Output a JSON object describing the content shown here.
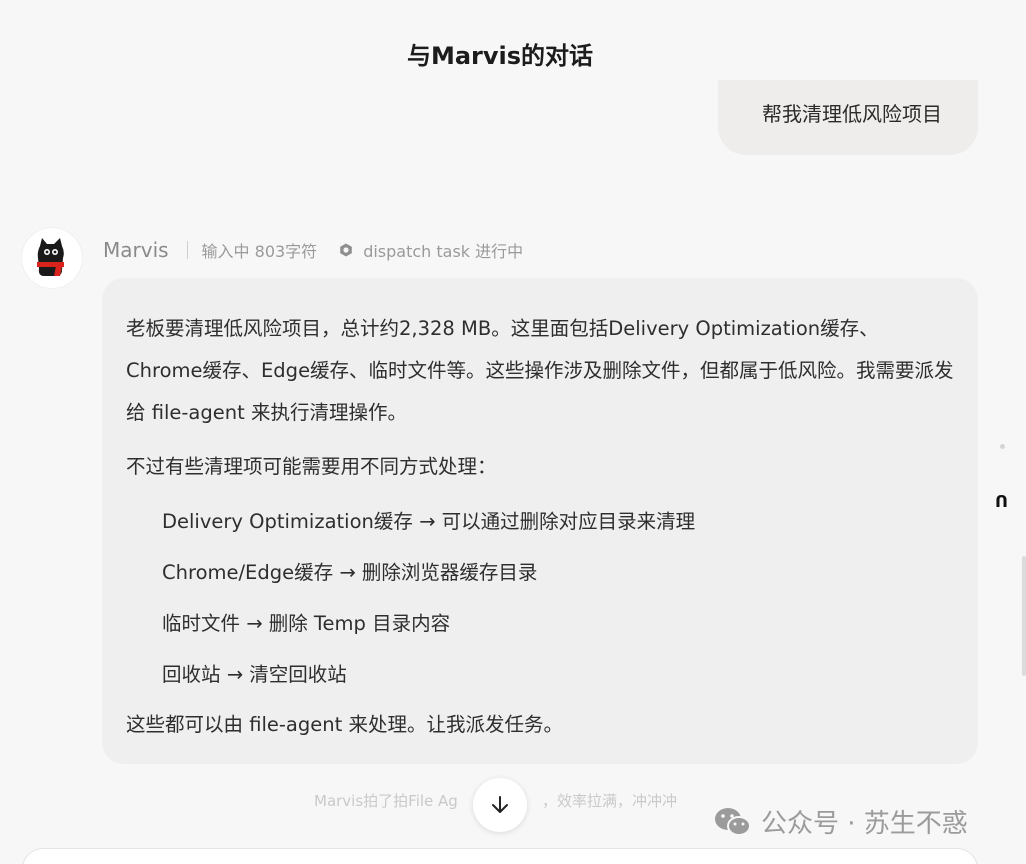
{
  "header": {
    "title": "与Marvis的对话"
  },
  "user_message": {
    "text": "帮我清理低风险项目"
  },
  "assistant": {
    "name": "Marvis",
    "typing_status": "输入中 803字符",
    "task_status": "dispatch task 进行中",
    "paragraphs": [
      "老板要清理低风险项目，总计约2,328 MB。这里面包括Delivery Optimization缓存、Chrome缓存、Edge缓存、临时文件等。这些操作涉及删除文件，但都属于低风险。我需要派发给 file-agent 来执行清理操作。",
      "不过有些清理项可能需要用不同方式处理："
    ],
    "bullets": [
      "Delivery Optimization缓存 → 可以通过删除对应目录来清理",
      "Chrome/Edge缓存 → 删除浏览器缓存目录",
      "临时文件 → 删除 Temp 目录内容",
      "回收站 → 清空回收站"
    ],
    "closing": "这些都可以由 file-agent 来处理。让我派发任务。"
  },
  "footer": {
    "note_left": "Marvis拍了拍File Ag",
    "note_right": "，效率拉满，冲冲冲"
  },
  "watermark": {
    "text": "公众号 · 苏生不惑"
  },
  "side": {
    "icon_glyph": "ᑎ"
  },
  "colors": {
    "background": "#f7f7f7",
    "user_bubble": "#efedeb",
    "assistant_bubble": "#efefef",
    "muted_text": "#9a9a9a"
  },
  "icons": {
    "avatar": "black-cat-avatar-icon",
    "status": "hexagon-status-icon",
    "scroll": "arrow-down-icon",
    "watermark": "wechat-icon"
  }
}
